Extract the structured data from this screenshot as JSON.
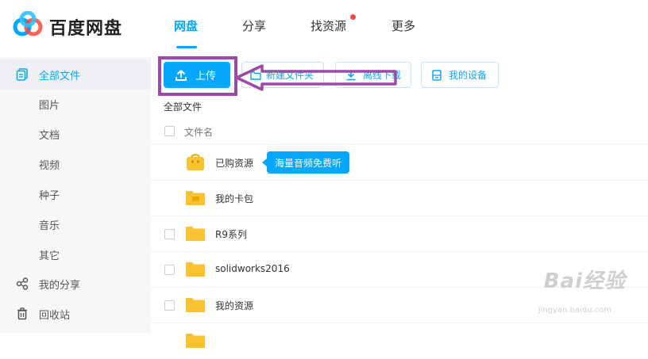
{
  "brand": {
    "title": "百度网盘"
  },
  "nav": {
    "items": [
      "网盘",
      "分享",
      "找资源",
      "更多"
    ]
  },
  "sidebar": {
    "items": [
      {
        "label": "全部文件",
        "icon": "files-icon"
      },
      {
        "label": "图片"
      },
      {
        "label": "文档"
      },
      {
        "label": "视频"
      },
      {
        "label": "种子"
      },
      {
        "label": "音乐"
      },
      {
        "label": "其它"
      },
      {
        "label": "我的分享",
        "icon": "share-icon"
      },
      {
        "label": "回收站",
        "icon": "trash-icon"
      }
    ]
  },
  "toolbar": {
    "upload": "上传",
    "new_folder": "新建文件夹",
    "offline": "离线下载",
    "devices": "我的设备"
  },
  "breadcrumb": "全部文件",
  "table": {
    "header": "文件名"
  },
  "files": [
    {
      "name": "已购资源",
      "type": "bag"
    },
    {
      "name": "我的卡包",
      "type": "card-folder"
    },
    {
      "name": "R9系列",
      "type": "folder"
    },
    {
      "name": "solidworks2016",
      "type": "folder"
    },
    {
      "name": "我的资源",
      "type": "folder"
    }
  ],
  "tooltip": "海量音频免费听",
  "watermark": {
    "main": "Bai经验",
    "sub": "jingyan.baidu.com"
  },
  "colors": {
    "accent": "#06a7ff",
    "highlight": "#9b4aa8",
    "folder": "#f9c231",
    "badge": "#f5483b"
  }
}
